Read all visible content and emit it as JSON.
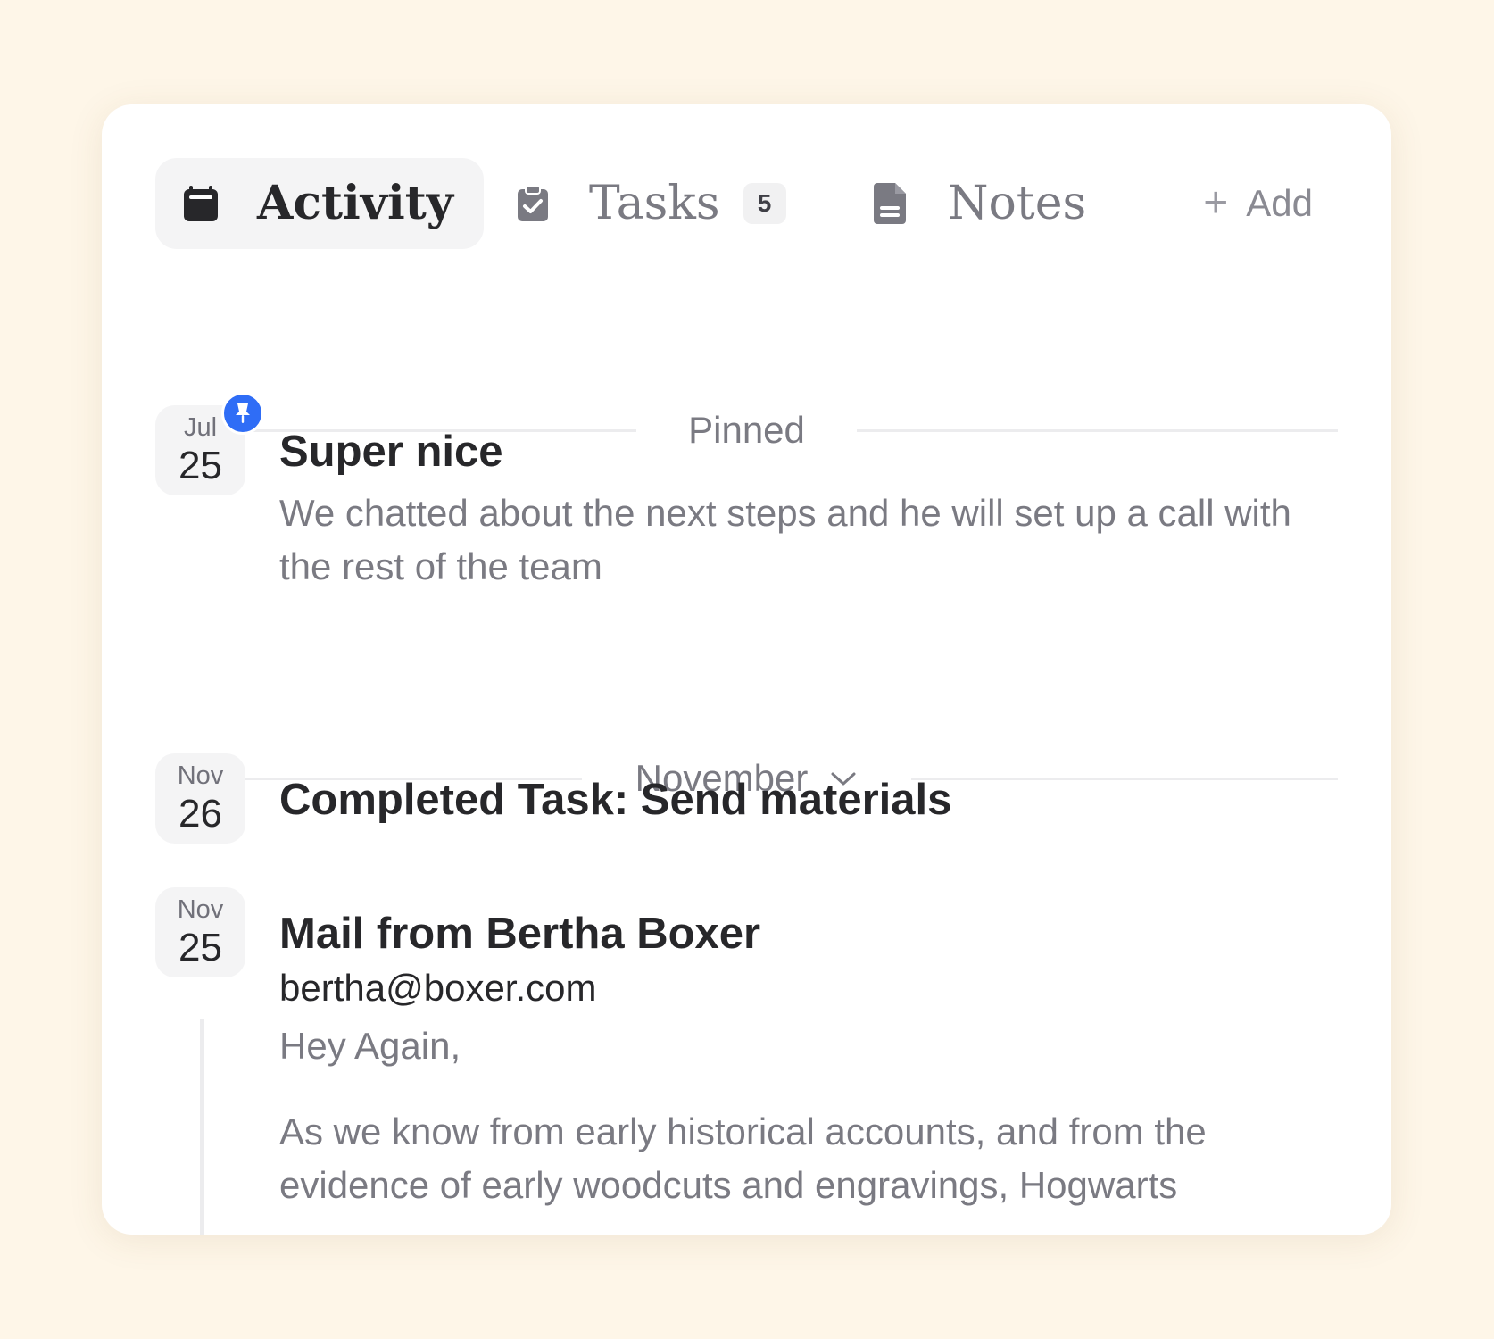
{
  "tabs": {
    "activity": {
      "label": "Activity",
      "icon": "calendar-icon",
      "active": true
    },
    "tasks": {
      "label": "Tasks",
      "icon": "clipboard-check-icon",
      "badge": "5"
    },
    "notes": {
      "label": "Notes",
      "icon": "document-icon"
    },
    "add": {
      "label": "Add",
      "icon": "plus-icon"
    }
  },
  "sections": {
    "pinned": {
      "label": "Pinned"
    },
    "november": {
      "label": "November"
    }
  },
  "entries": [
    {
      "month": "Jul",
      "day": "25",
      "pinned": true,
      "title": "Super nice",
      "body": "We chatted about the next steps and he will set up a call with the rest of the team"
    },
    {
      "month": "Nov",
      "day": "26",
      "title": "Completed Task: Send materials"
    },
    {
      "month": "Nov",
      "day": "25",
      "title": "Mail from Bertha Boxer",
      "email": "bertha@boxer.com",
      "greeting": "Hey Again,",
      "body": "As we know from early historical accounts, and from the evidence of early woodcuts and engravings, Hogwarts"
    }
  ],
  "colors": {
    "background": "#fef6e8",
    "card": "#ffffff",
    "pin_accent": "#2f6df6",
    "text_primary": "#27272a",
    "text_muted": "#7a7a82"
  }
}
